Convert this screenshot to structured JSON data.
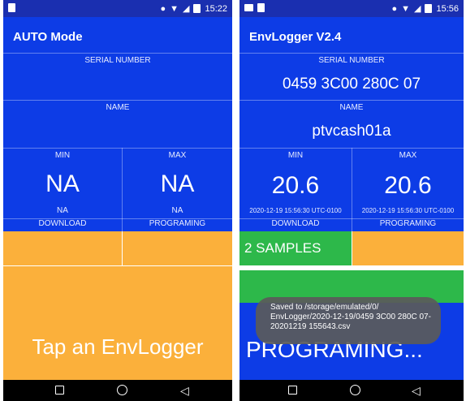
{
  "screen1": {
    "status_time": "15:22",
    "title": "AUTO Mode",
    "serial_label": "SERIAL NUMBER",
    "serial_value": "",
    "name_label": "NAME",
    "name_value": "",
    "min_label": "MIN",
    "min_value": "NA",
    "min_time": "NA",
    "max_label": "MAX",
    "max_value": "NA",
    "max_time": "NA",
    "download_label": "DOWNLOAD",
    "programing_label": "PROGRAMING",
    "message": "Tap an EnvLogger"
  },
  "screen2": {
    "status_time": "15:56",
    "title": "EnvLogger V2.4",
    "serial_label": "SERIAL NUMBER",
    "serial_value": "0459 3C00 280C 07",
    "name_label": "NAME",
    "name_value": "ptvcash01a",
    "min_label": "MIN",
    "min_value": "20.6",
    "min_time": "2020-12-19 15:56:30 UTC-0100",
    "max_label": "MAX",
    "max_value": "20.6",
    "max_time": "2020-12-19 15:56:30 UTC-0100",
    "download_label": "DOWNLOAD",
    "programing_label": "PROGRAMING",
    "samples": "2 SAMPLES",
    "message": "PROGRAMING...",
    "toast": "Saved to /storage/emulated/0/ EnvLogger/2020-12-19/0459 3C00 280C 07-20201219 155643.csv"
  },
  "colors": {
    "blue": "#0d3ce6",
    "statusbar": "#1a2fb0",
    "orange": "#fbb03b",
    "green": "#2db84a"
  },
  "icons": [
    "sim-icon",
    "location-icon",
    "wifi-icon",
    "signal-icon",
    "battery-icon",
    "nav-recents-icon",
    "nav-home-icon",
    "nav-back-icon"
  ]
}
